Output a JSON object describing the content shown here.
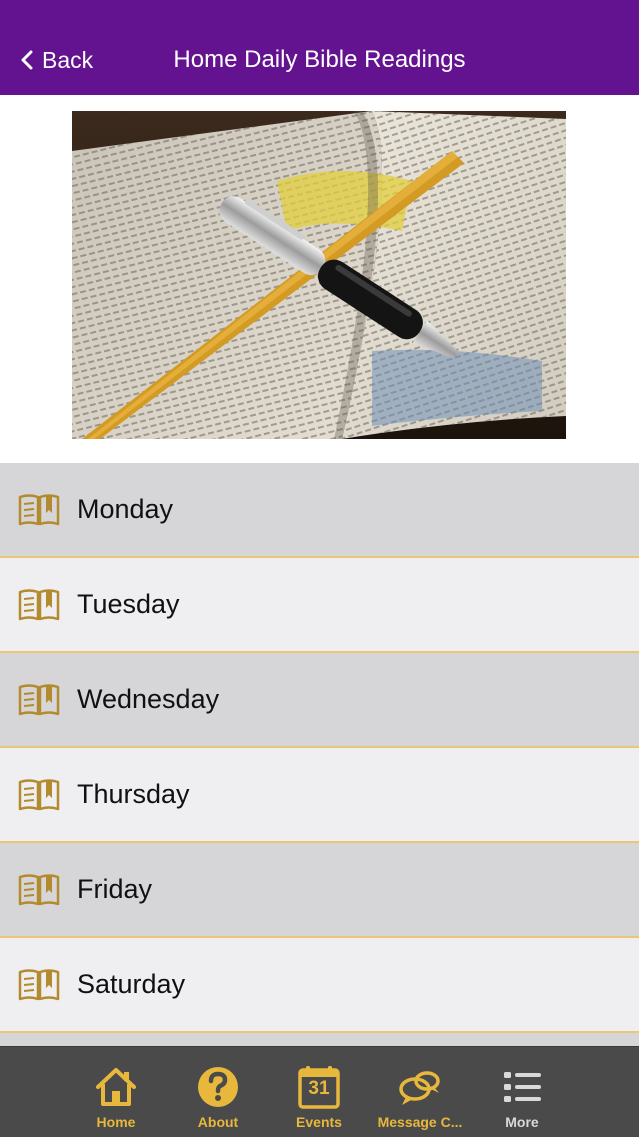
{
  "header": {
    "back_label": "Back",
    "title": "Home Daily Bible Readings"
  },
  "hero": {
    "alt": "Open Bible with a pen and bookmark ribbon"
  },
  "days": [
    {
      "label": "Monday"
    },
    {
      "label": "Tuesday"
    },
    {
      "label": "Wednesday"
    },
    {
      "label": "Thursday"
    },
    {
      "label": "Friday"
    },
    {
      "label": "Saturday"
    }
  ],
  "tabs": [
    {
      "label": "Home",
      "icon": "home-icon"
    },
    {
      "label": "About",
      "icon": "question-icon"
    },
    {
      "label": "Events",
      "icon": "calendar-icon",
      "calendar_day": "31"
    },
    {
      "label": "Message C...",
      "icon": "chat-bubbles-icon"
    },
    {
      "label": "More",
      "icon": "list-icon"
    }
  ],
  "colors": {
    "nav_bg": "#63138f",
    "accent_gold": "#e8b83c",
    "row_alt": "#d6d6d8",
    "row": "#efeff1",
    "tab_bg": "#4a4a4a",
    "tab_inactive": "#d9d9d9"
  }
}
